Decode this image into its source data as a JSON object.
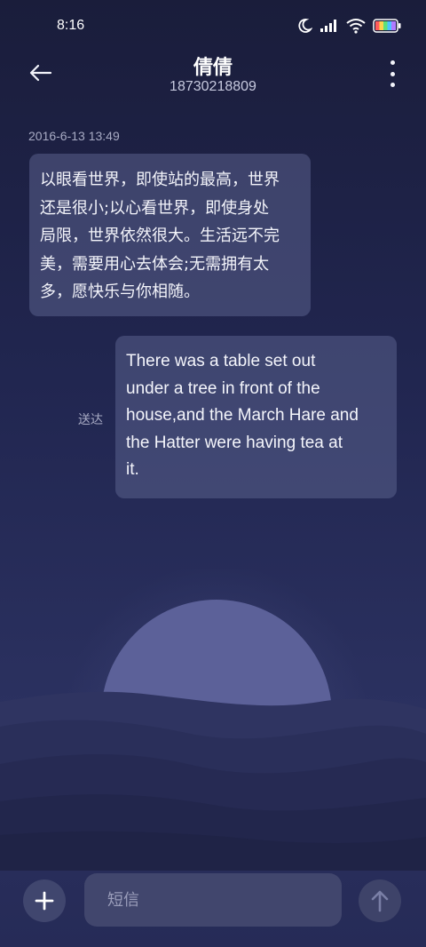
{
  "status_bar": {
    "time": "8:16",
    "icons": [
      "moon-icon",
      "signal-icon",
      "wifi-icon",
      "battery-icon"
    ]
  },
  "header": {
    "back_icon": "back-arrow-icon",
    "contact_name": "倩倩",
    "contact_number": "18730218809",
    "more_icon": "more-vertical-icon"
  },
  "conversation": {
    "timestamp": "2016-6-13 13:49",
    "messages": [
      {
        "direction": "incoming",
        "lines": [
          "以眼看世界，即使站的最高，世界",
          "还是很小;以心看世界，即使身处",
          "局限，世界依然很大。生活远不完",
          "美，需要用心去体会;无需拥有太",
          "多，愿快乐与你相随。"
        ]
      },
      {
        "direction": "outgoing",
        "lines": [
          "There was a table set out",
          "under a tree in front of the",
          "house,and the March Hare and",
          "the Hatter were having tea at",
          "it."
        ],
        "status": "送达"
      }
    ]
  },
  "composer": {
    "add_icon": "plus-icon",
    "placeholder": "短信",
    "send_icon": "send-arrow-icon"
  },
  "colors": {
    "background_top": "#1a1d3b",
    "background_bottom": "#2b3160",
    "bubble": "#4d5283",
    "moon": "#5c6199"
  }
}
